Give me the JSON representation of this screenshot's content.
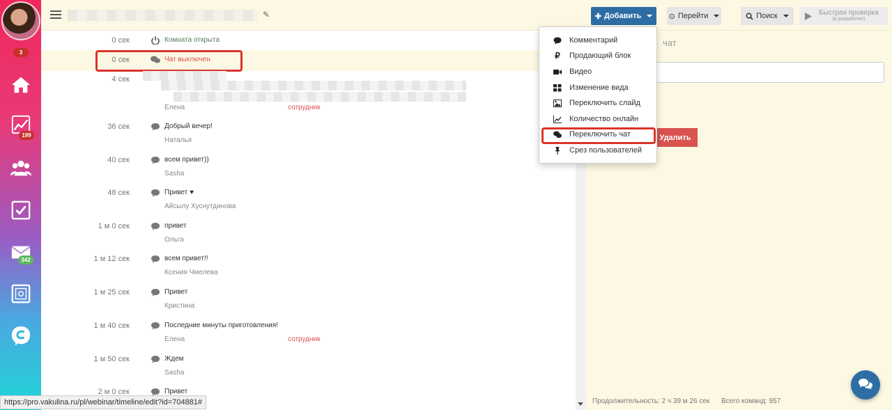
{
  "sidebar": {
    "badges": {
      "notifications": "3",
      "stats": "199",
      "mail": "342"
    },
    "icons": [
      "home-icon",
      "chart-icon",
      "users-icon",
      "checkbox-icon",
      "mail-icon",
      "safe-icon",
      "c-icon"
    ],
    "colors": {
      "gradient_top": "#f0285a",
      "gradient_bottom": "#1fd6d8"
    }
  },
  "topbar": {
    "add_label": "Добавить",
    "goto_label": "Перейти",
    "search_label": "Поиск",
    "quick_label_line1": "Быстрая проверка",
    "quick_label_line2": "(в разработке)"
  },
  "timeline": {
    "rows": [
      {
        "time": "0 сек",
        "icon": "power-icon",
        "message": "Комната открыта",
        "author": "",
        "role": ""
      },
      {
        "time": "0 сек",
        "icon": "chat-icon",
        "message": "Чат выключен",
        "author": "",
        "role": ""
      },
      {
        "time": "4 сек",
        "icon": "",
        "message": "",
        "author": "Елена",
        "role": "сотрудник"
      },
      {
        "time": "36 сек",
        "icon": "chat-icon",
        "message": "Добрый вечер!",
        "author": "Наталья",
        "role": ""
      },
      {
        "time": "40 сек",
        "icon": "chat-icon",
        "message": "всем привет))",
        "author": "Sasha",
        "role": ""
      },
      {
        "time": "48 сек",
        "icon": "chat-icon",
        "message": "Привет ♥",
        "author": "Айсылу Хуснутдинова",
        "role": ""
      },
      {
        "time": "1 м 0 сек",
        "icon": "chat-icon",
        "message": "привет",
        "author": "Ольга",
        "role": ""
      },
      {
        "time": "1 м 12 сек",
        "icon": "chat-icon",
        "message": "всем привет!!",
        "author": "Ксения Чмелева",
        "role": ""
      },
      {
        "time": "1 м 25 сек",
        "icon": "chat-icon",
        "message": "Привет",
        "author": "Кристина",
        "role": ""
      },
      {
        "time": "1 м 40 сек",
        "icon": "chat-icon",
        "message": "Последние минуты приготовления!",
        "author": "Елена",
        "role": "сотрудник"
      },
      {
        "time": "1 м 50 сек",
        "icon": "chat-icon",
        "message": "Ждем",
        "author": "Sasha",
        "role": ""
      },
      {
        "time": "2 м 0 сек",
        "icon": "chat-icon",
        "message": "Привет",
        "author": "",
        "role": ""
      }
    ]
  },
  "dropdown": {
    "items": [
      {
        "label": "Комментарий",
        "icon": "comment-icon"
      },
      {
        "label": "Продающий блок",
        "icon": "ruble-icon"
      },
      {
        "label": "Видео",
        "icon": "video-icon"
      },
      {
        "label": "Изменение вида",
        "icon": "grid-icon"
      },
      {
        "label": "Переключить слайд",
        "icon": "image-icon"
      },
      {
        "label": "Количество онлайн",
        "icon": "line-chart-icon"
      },
      {
        "label": "Переключить чат",
        "icon": "chat-icon"
      },
      {
        "label": "Срез пользователей",
        "icon": "pin-icon"
      }
    ]
  },
  "right_panel": {
    "title_fragment": "чат",
    "delete_label": "Удалить",
    "duration": "Продолжительность: 2 ч 39 м 26 сек",
    "total_commands": "Всего команд: 957"
  },
  "status_url": "https://pro.vakulina.ru/pl/webinar/timeline/edit?id=704881#",
  "colors": {
    "accent": "#2e6da4",
    "danger": "#d9534f",
    "highlight_frame": "#d9342b",
    "panel_bg": "#fcf8e3"
  }
}
